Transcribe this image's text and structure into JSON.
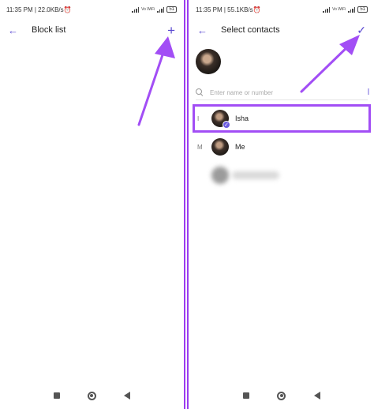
{
  "left": {
    "status_time": "11:35 PM | 22.0KB/s",
    "status_network": "Vo WiFi",
    "status_battery": "51",
    "title": "Block list",
    "action_glyph": "+"
  },
  "right": {
    "status_time": "11:35 PM | 55.1KB/s",
    "status_network": "Vo WiFi",
    "status_battery": "51",
    "title": "Select contacts",
    "action_glyph": "✓",
    "search_placeholder": "Enter name or number",
    "contacts": [
      {
        "letter": "I",
        "name": "Isha",
        "selected": true
      },
      {
        "letter": "M",
        "name": "Me",
        "selected": false
      }
    ]
  },
  "icons": {
    "back": "arrow-left-icon",
    "add": "plus-icon",
    "confirm": "checkmark-icon",
    "search": "search-icon"
  },
  "colors": {
    "accent": "#5b4ad1",
    "annotation": "#a24ef5"
  }
}
